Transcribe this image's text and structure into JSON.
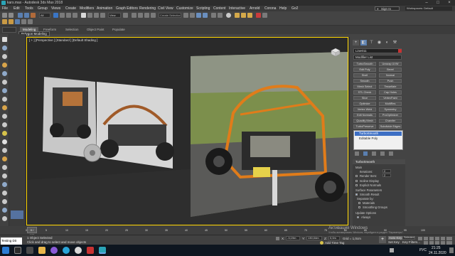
{
  "window": {
    "title": "kars.max - Autodesk 3ds Max 2018"
  },
  "menu": {
    "items": [
      "File",
      "Edit",
      "Tools",
      "Group",
      "Views",
      "Create",
      "Modifiers",
      "Animation",
      "Graph Editors",
      "Rendering",
      "Civil View",
      "Customize",
      "Scripting",
      "Content",
      "Interactive",
      "Arnold",
      "Corona",
      "Help",
      "Go2"
    ],
    "sign_in": "Sign In",
    "workspaces_label": "Workspaces:",
    "workspaces_value": "Default"
  },
  "toolbar": {
    "selection_set_placeholder": "Create Selection Se"
  },
  "ribbon": {
    "tabs": [
      "Modeling",
      "Freeform",
      "Selection",
      "Object Paint",
      "Populate"
    ],
    "submenu": "Polygon Modeling"
  },
  "viewport": {
    "label": "[ + ] [Perspective ] [Standard ] [Default Shading ]"
  },
  "command_panel": {
    "object_name": "Line011",
    "modifier_list": "Modifier List",
    "buttons": [
      [
        "TurboSmooth",
        "Unwrap UVW"
      ],
      [
        "Edit Poly",
        "Bevel"
      ],
      [
        "Shell",
        "Normal"
      ],
      [
        "Smooth",
        "Push"
      ],
      [
        "Mesh Select",
        "Tessellate"
      ],
      [
        "STL Check",
        "Cap Holes"
      ],
      [
        "Slice",
        "VertexPaint"
      ],
      [
        "Optimize",
        "MultiRes"
      ],
      [
        "Vertex Weld",
        "Symmetry"
      ],
      [
        "Edit Normals",
        "ProOptimizer"
      ],
      [
        "Quadify Mesh",
        "Chamfer"
      ],
      [
        "TurboPreserve",
        "Subdivide Edges"
      ]
    ],
    "stack": [
      "TurboSmooth",
      "Editable Poly"
    ],
    "rollout": {
      "title": "TurboSmooth",
      "main_label": "Main",
      "iterations_label": "Iterations:",
      "iterations_value": "2",
      "render_iters_label": "Render Iters:",
      "render_iters_value": "2",
      "isoline": "Isoline Display",
      "explicit": "Explicit Normals",
      "surface_label": "Surface Parameters",
      "smooth_result": "Smooth Result",
      "separate_label": "Separate by:",
      "materials": "Materials",
      "smoothing": "Smoothing Groups",
      "update_label": "Update Options",
      "always": "Always"
    }
  },
  "timeline": {
    "frame_counter": "0 / 100",
    "ticks": [
      "0",
      "5",
      "10",
      "15",
      "20",
      "25",
      "30",
      "35",
      "40",
      "45",
      "50",
      "55",
      "60",
      "65",
      "70",
      "75",
      "80",
      "85",
      "90",
      "95",
      "100"
    ]
  },
  "status": {
    "maxscript": "Testing Dit",
    "selected": "1 Object Selected",
    "prompt": "Click and drag to select and move objects",
    "x_label": "X:",
    "x_value": "-3,19m",
    "y_label": "Y:",
    "y_value": "130,04m",
    "z_label": "Z:",
    "z_value": "0,0m",
    "grid": "Grid = 1,0cm",
    "add_time_tag": "Add Time Tag",
    "auto_key": "Auto Key",
    "selected_dd": "Selected",
    "set_key": "Set Key",
    "key_filters": "Key Filters...",
    "activate_title": "Активация Windows",
    "activate_sub": "Чтобы активировать Windows, перейдите в раздел \"Параметры\"."
  },
  "taskbar": {
    "lang": "РУС",
    "time": "21:25",
    "date": "24.11.2020"
  }
}
